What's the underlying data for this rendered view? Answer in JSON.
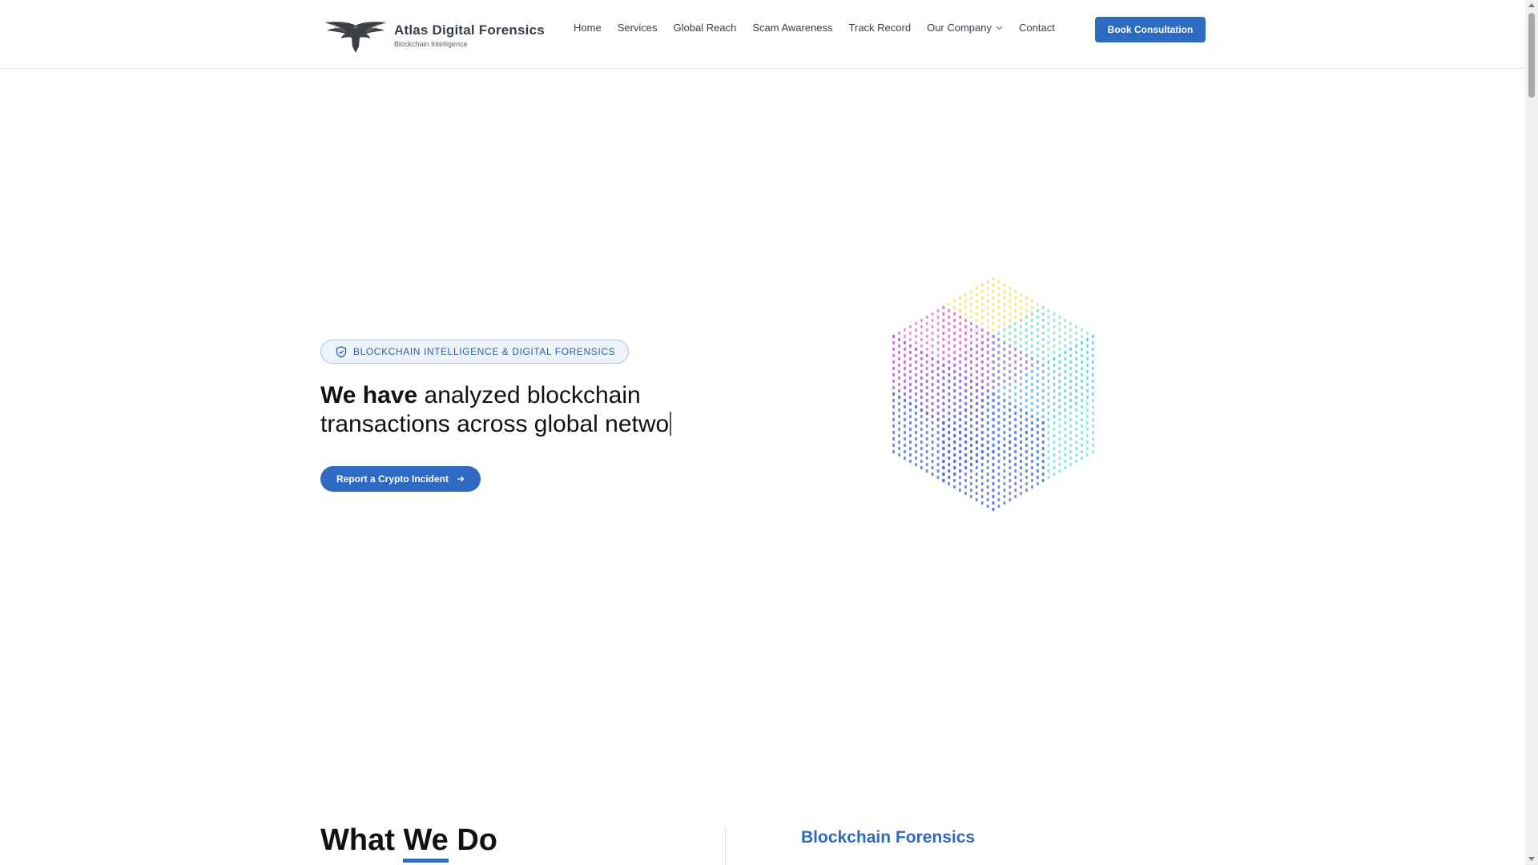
{
  "header": {
    "brand_name": "Atlas Digital Forensics",
    "brand_tagline": "Blockchain Intelligence",
    "cta_label": "Book Consultation"
  },
  "nav": {
    "items": [
      {
        "label": "Home"
      },
      {
        "label": "Services"
      },
      {
        "label": "Global Reach"
      },
      {
        "label": "Scam Awareness"
      },
      {
        "label": "Track Record"
      },
      {
        "label": "Our Company",
        "has_dropdown": true
      },
      {
        "label": "Contact"
      }
    ]
  },
  "hero": {
    "badge_text": "BLOCKCHAIN INTELLIGENCE & DIGITAL FORENSICS",
    "headline_bold": "We have",
    "headline_rest": " analyzed blockchain transactions across global netwo",
    "cta_label": "Report a Crypto Incident"
  },
  "what_we_do": {
    "title_pre": "What ",
    "title_we": "We",
    "title_post": " Do",
    "first_service": "Blockchain Forensics"
  },
  "colors": {
    "accent": "#2f6ac2",
    "text": "#111111",
    "nav_text": "#3a3f47"
  },
  "icons": [
    "eagle-logo",
    "shield-icon",
    "chevron-down-icon",
    "arrow-right-icon"
  ]
}
